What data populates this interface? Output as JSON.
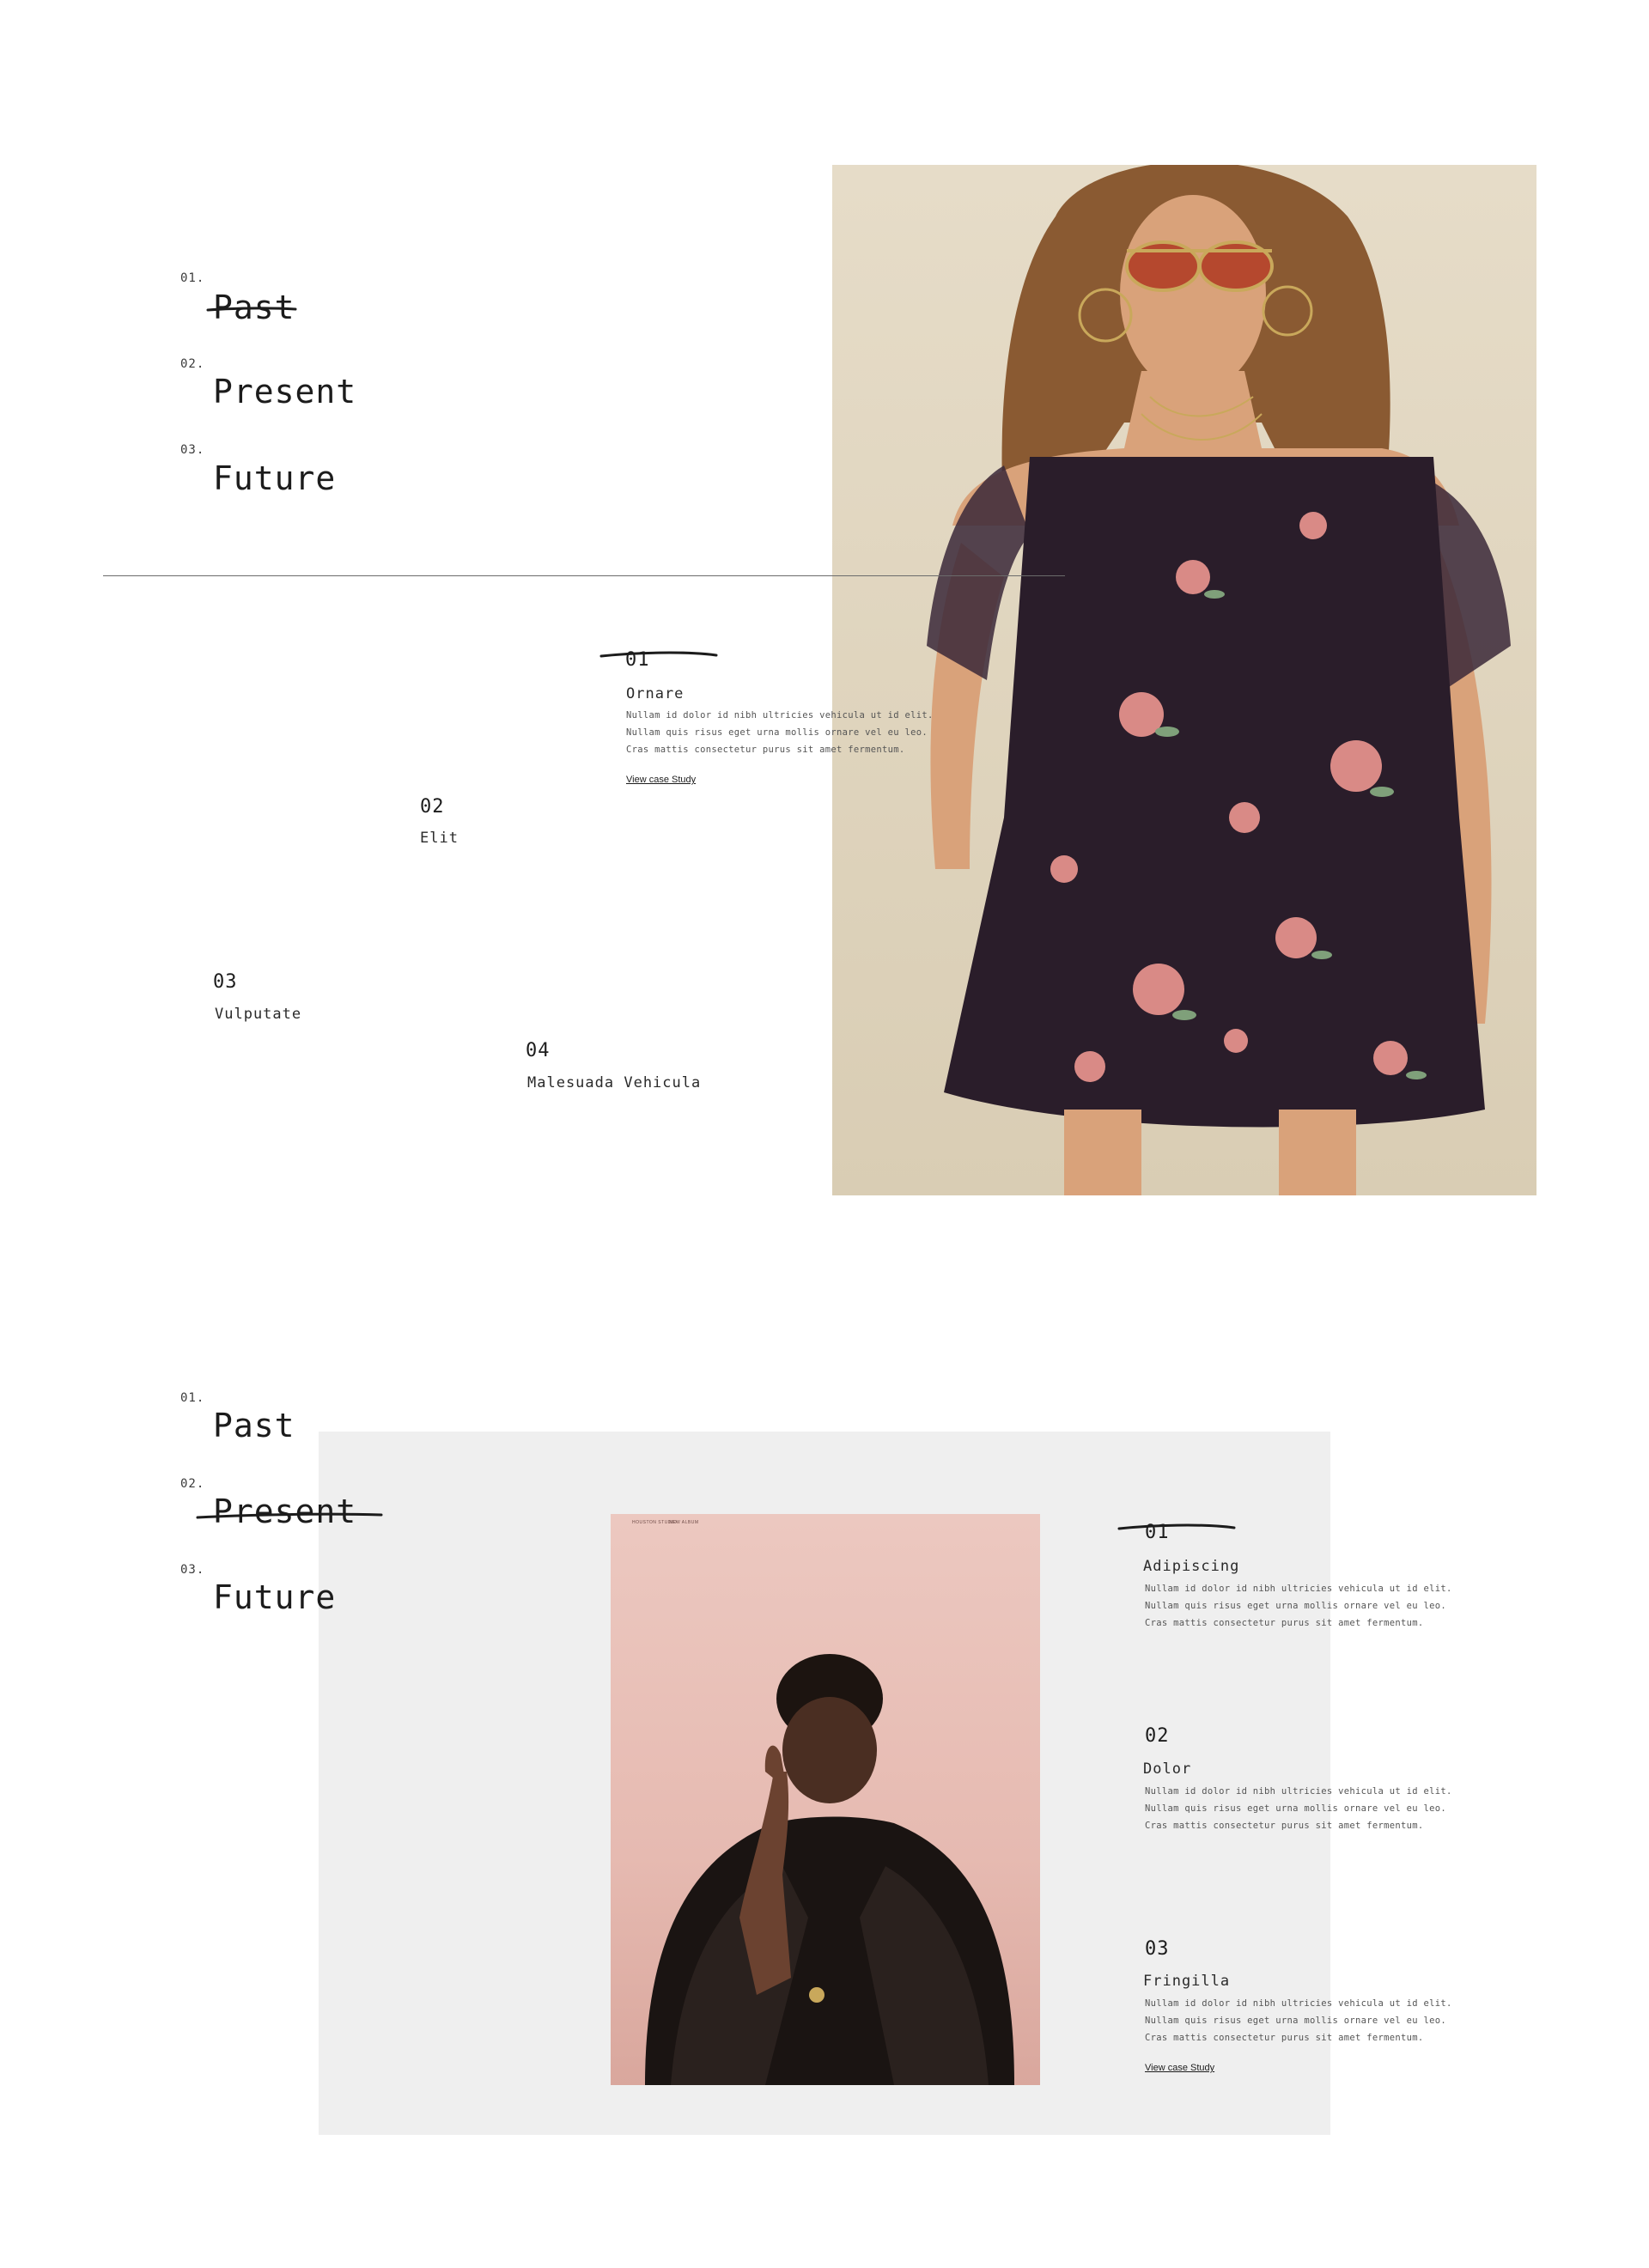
{
  "section1": {
    "nav": [
      {
        "num": "01.",
        "label": "Past"
      },
      {
        "num": "02.",
        "label": "Present"
      },
      {
        "num": "03.",
        "label": "Future"
      }
    ],
    "items": [
      {
        "num": "01",
        "title": "Ornare",
        "body": [
          "Nullam id dolor id nibh ultricies vehicula ut id elit.",
          "Nullam quis risus eget urna mollis ornare vel eu leo.",
          "Cras mattis consectetur purus sit amet fermentum."
        ],
        "link": "View case Study"
      },
      {
        "num": "02",
        "title": "Elit"
      },
      {
        "num": "03",
        "title": "Vulputate"
      },
      {
        "num": "04",
        "title": "Malesuada Vehicula"
      }
    ]
  },
  "section2": {
    "nav": [
      {
        "num": "01.",
        "label": "Past"
      },
      {
        "num": "02.",
        "label": "Present"
      },
      {
        "num": "03.",
        "label": "Future"
      }
    ],
    "photo_caption": [
      "HOUSTON STUDIO",
      "NEW ALBUM"
    ],
    "items": [
      {
        "num": "01",
        "title": "Adipiscing",
        "body": [
          "Nullam id dolor id nibh ultricies vehicula ut id elit.",
          "Nullam quis risus eget urna mollis ornare vel eu leo.",
          "Cras mattis consectetur purus sit amet fermentum."
        ]
      },
      {
        "num": "02",
        "title": "Dolor",
        "body": [
          "Nullam id dolor id nibh ultricies vehicula ut id elit.",
          "Nullam quis risus eget urna mollis ornare vel eu leo.",
          "Cras mattis consectetur purus sit amet fermentum."
        ]
      },
      {
        "num": "03",
        "title": "Fringilla",
        "body": [
          "Nullam id dolor id nibh ultricies vehicula ut id elit.",
          "Nullam quis risus eget urna mollis ornare vel eu leo.",
          "Cras mattis consectetur purus sit amet fermentum."
        ],
        "link": "View case Study"
      }
    ]
  },
  "colors": {
    "ink": "#1c1c1c",
    "muted": "#555555",
    "beige_photo_bg": "#e2d8c2",
    "grey_panel": "#efefef",
    "pink_photo_bg": "#e8c1b9",
    "dress": "#2a1d2a"
  }
}
